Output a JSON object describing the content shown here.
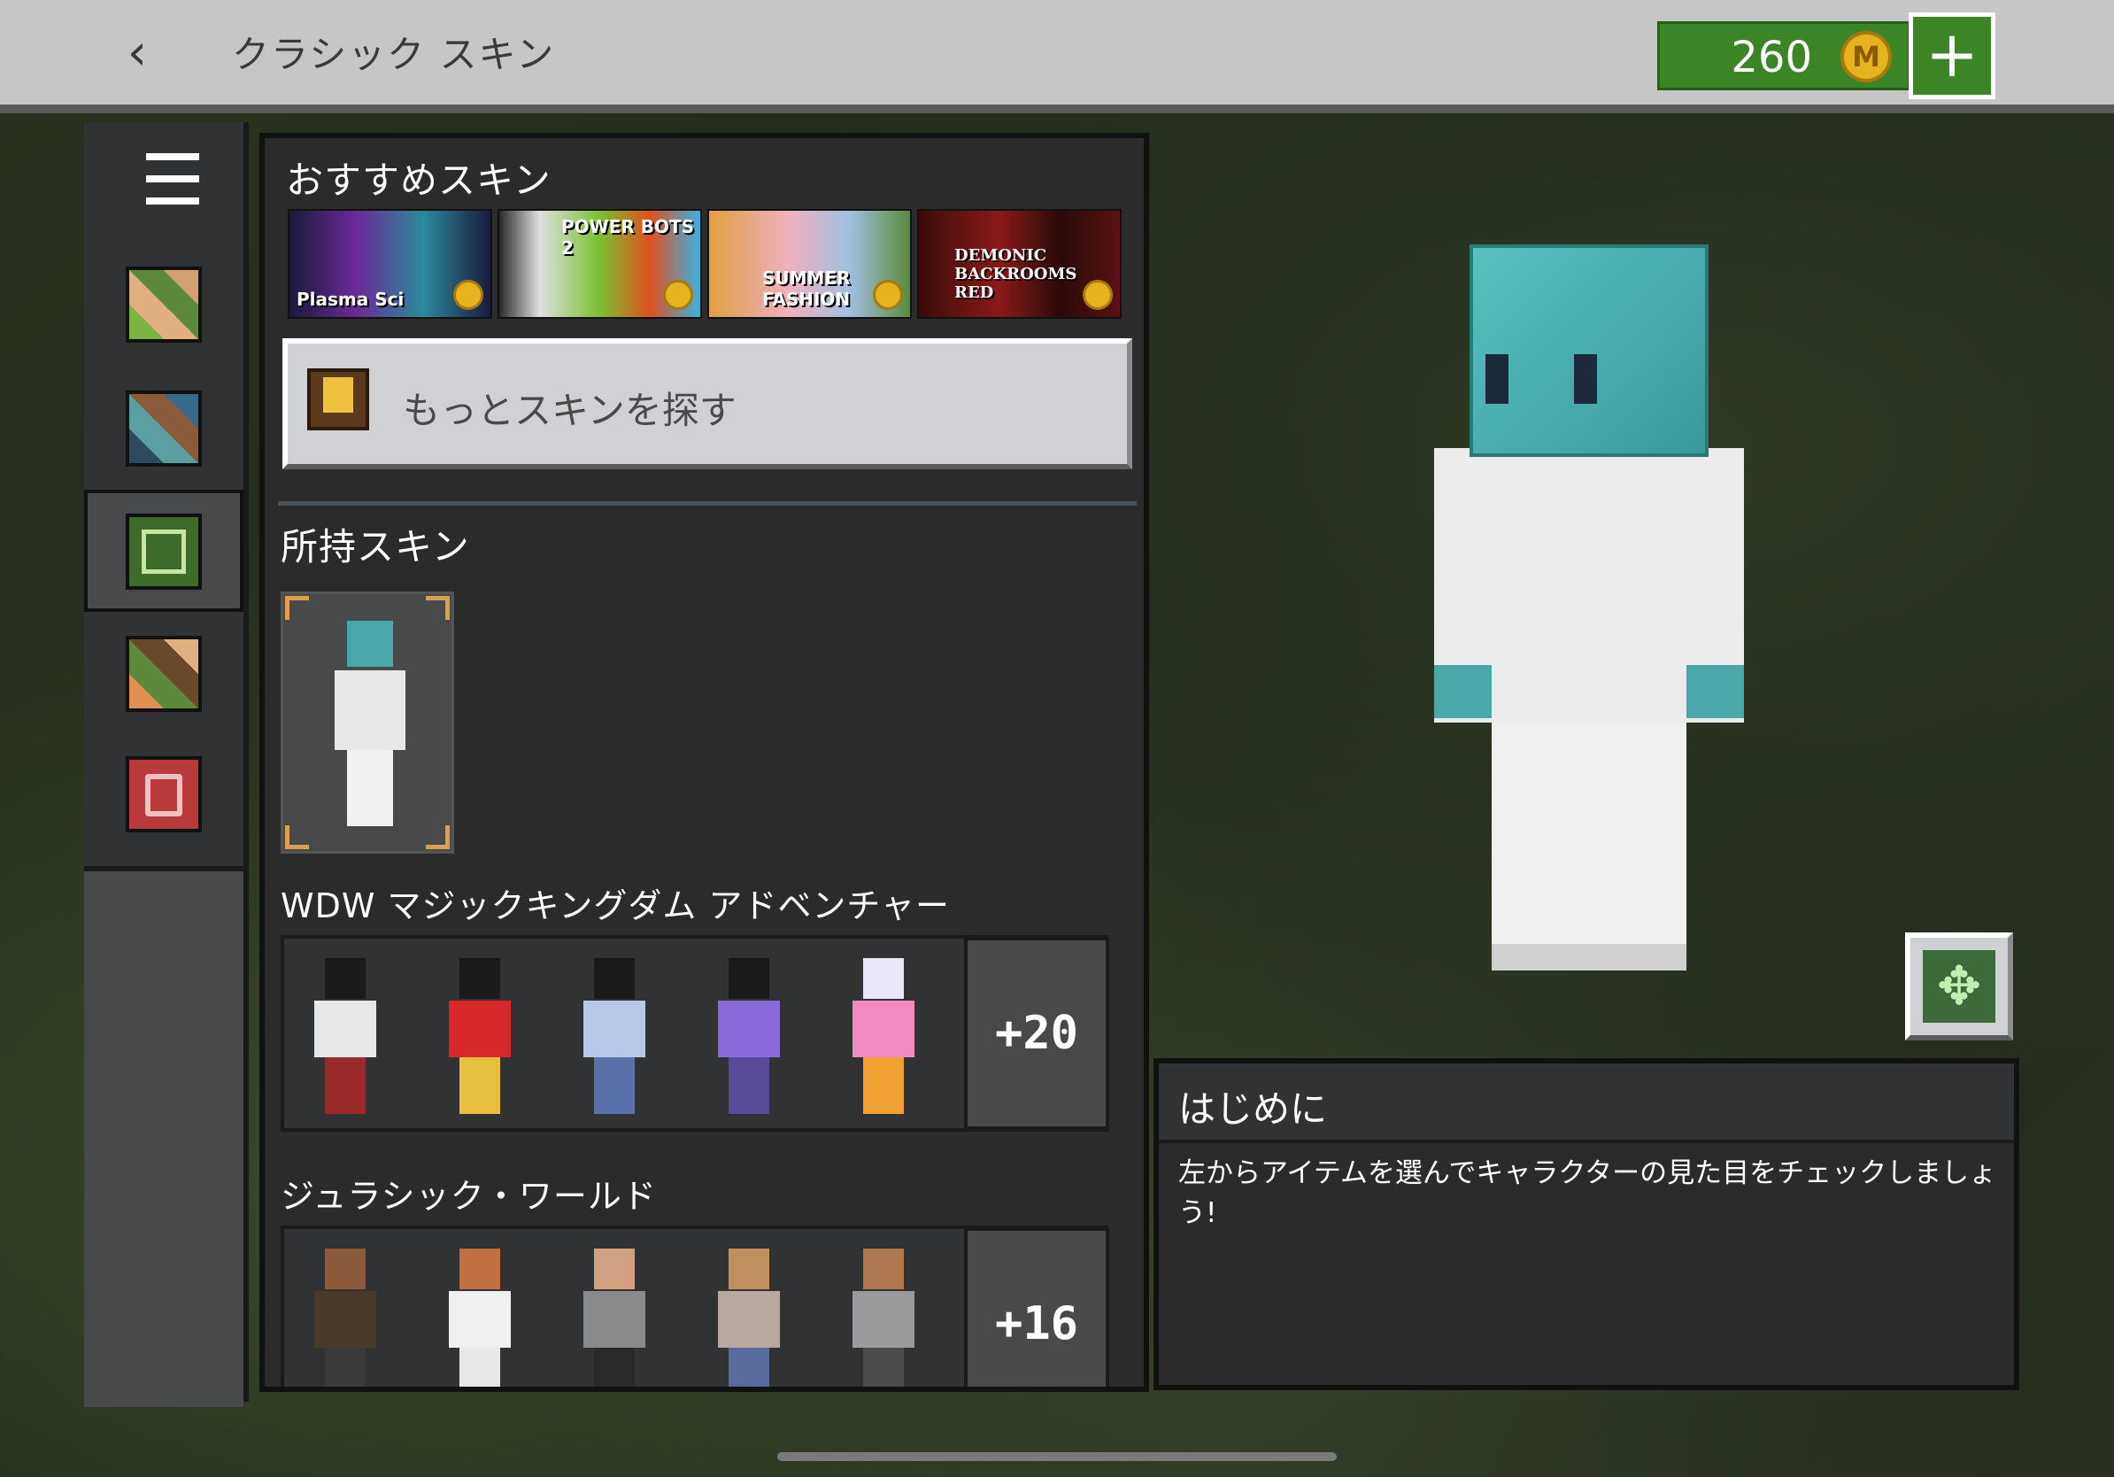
{
  "header": {
    "back_icon": "chevron-left-icon",
    "title": "クラシック スキン",
    "coin_amount": "260",
    "coin_icon_letter": "M",
    "add_label": "+"
  },
  "sidebar": {
    "menu_icon": "hamburger-icon",
    "items": [
      {
        "icon": "skin-pack-icon"
      },
      {
        "icon": "character-icon"
      },
      {
        "icon": "classic-skin-icon"
      },
      {
        "icon": "emote-icon"
      },
      {
        "icon": "wardrobe-icon"
      }
    ]
  },
  "featured": {
    "title": "おすすめスキン",
    "banners": [
      {
        "label": "Plasma Sci"
      },
      {
        "label": "POWER BOTS 2"
      },
      {
        "label": "SUMMER FASHION"
      },
      {
        "label": "DEMONIC BACKROOMS RED"
      }
    ],
    "find_more_label": "もっとスキンを探す"
  },
  "owned": {
    "title": "所持スキン"
  },
  "packs": [
    {
      "title": "WDW マジックキングダム アドベンチャー",
      "more_label": "+20"
    },
    {
      "title": "ジュラシック・ワールド",
      "more_label": "+16"
    }
  ],
  "info": {
    "title": "はじめに",
    "description": "左からアイテムを選んでキャラクターの見た目をチェックしましょう!"
  },
  "colors": {
    "accent_green": "#3c8527",
    "coin_gold": "#e6b31e",
    "panel_dark": "#2b2b2b"
  }
}
